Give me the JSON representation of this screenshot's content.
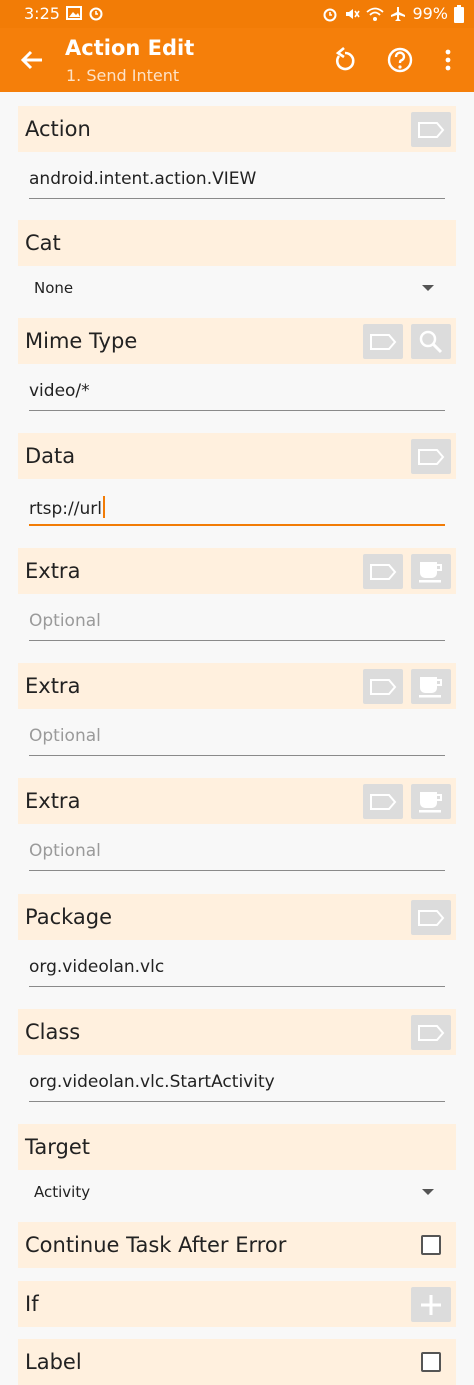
{
  "status_bar": {
    "time": "3:25",
    "battery": "99%",
    "left_icons": [
      "image-icon",
      "alarm-icon"
    ],
    "right_icons": [
      "alarm-icon",
      "mute-icon",
      "wifi-icon",
      "airplane-icon",
      "battery-icon"
    ]
  },
  "app_bar": {
    "title": "Action Edit",
    "subtitle": "1. Send Intent",
    "color": "#f57f0a"
  },
  "sections": {
    "action": {
      "label": "Action",
      "value": "android.intent.action.VIEW"
    },
    "cat": {
      "label": "Cat",
      "value": "None"
    },
    "mime_type": {
      "label": "Mime Type",
      "value": "video/*"
    },
    "data": {
      "label": "Data",
      "value": "rtsp://url"
    },
    "extra1": {
      "label": "Extra",
      "placeholder": "Optional"
    },
    "extra2": {
      "label": "Extra",
      "placeholder": "Optional"
    },
    "extra3": {
      "label": "Extra",
      "placeholder": "Optional"
    },
    "package": {
      "label": "Package",
      "value": "org.videolan.vlc"
    },
    "class": {
      "label": "Class",
      "value": "org.videolan.vlc.StartActivity"
    },
    "target": {
      "label": "Target",
      "value": "Activity"
    },
    "continue_task": {
      "label": "Continue Task After Error"
    },
    "if": {
      "label": "If"
    },
    "label": {
      "label": "Label"
    }
  }
}
